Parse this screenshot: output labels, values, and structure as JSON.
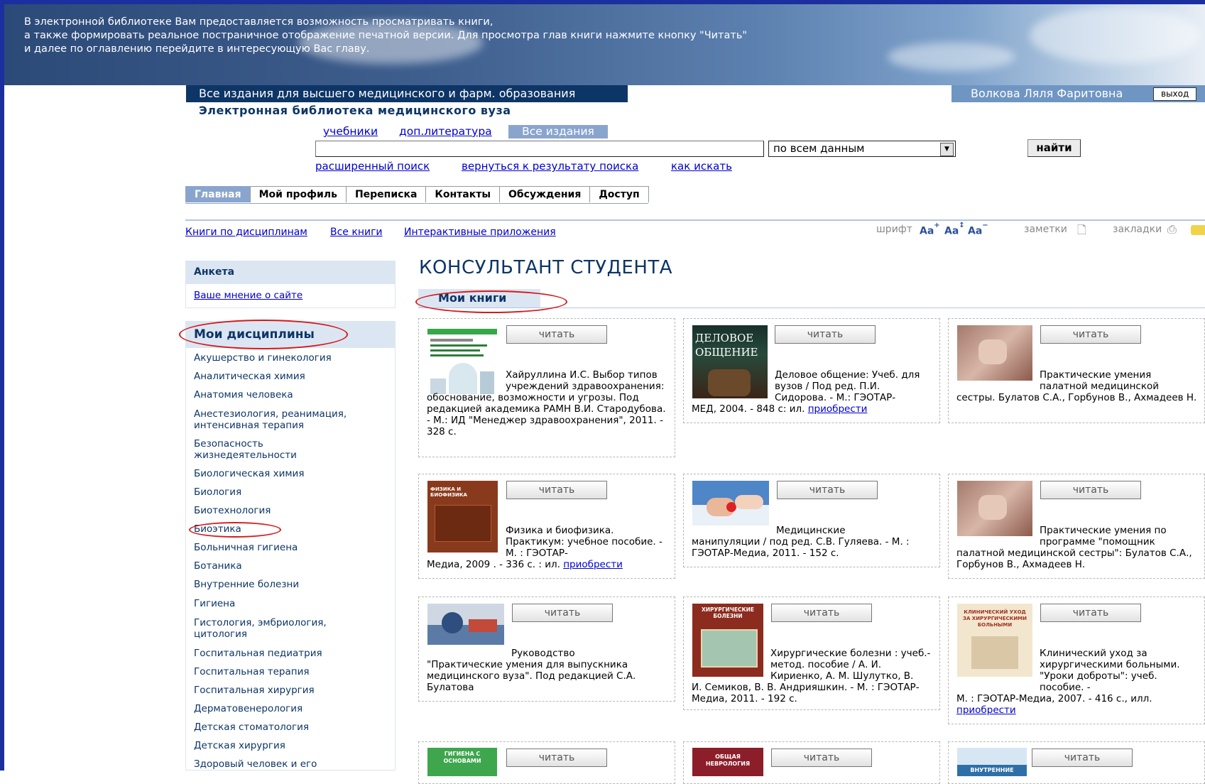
{
  "intro": [
    "В электронной библиотеке Вам предоставляется возможность просматривать книги,",
    "а также формировать реальное постраничное отображение печатной версии. Для просмотра глав книги нажмите кнопку \"Читать\"",
    "и далее по оглавлению перейдите в интересующую Вас главу."
  ],
  "header": {
    "scope": "Все издания для высшего медицинского и фарм. образования",
    "library_title": "Электронная библиотека медицинского вуза",
    "user_name": "Волкова Ляля Фаритовна",
    "logout": "выход"
  },
  "search": {
    "tabs": [
      "учебники",
      "доп.литература"
    ],
    "active_tab": "Все издания",
    "query": "",
    "scope_select": "по всем данным",
    "find_button": "найти",
    "links": [
      "расширенный поиск",
      "вернуться к результату поиска",
      "как искать"
    ]
  },
  "nav": {
    "tabs": [
      "Главная",
      "Мой профиль",
      "Переписка",
      "Контакты",
      "Обсуждения",
      "Доступ"
    ],
    "active": "Главная"
  },
  "sublinks": [
    "Книги по дисциплинам",
    "Все книги",
    "Интерактивные приложения"
  ],
  "tools": {
    "font_label": "шрифт",
    "notes_label": "заметки",
    "bookmarks_label": "закладки",
    "font_icon_glyph": "Aa"
  },
  "sidebar": {
    "survey_title": "Анкета",
    "survey_link": "Ваше мнение о сайте",
    "disciplines_title": "Мои дисциплины",
    "disciplines": [
      "Акушерство и гинекология",
      "Аналитическая химия",
      "Анатомия человека",
      "Анестезиология, реанимация, интенсивная терапия",
      "Безопасность жизнедеятельности",
      "Биологическая химия",
      "Биология",
      "Биотехнология",
      "Биоэтика",
      "Больничная гигиена",
      "Ботаника",
      "Внутренние болезни",
      "Гигиена",
      "Гистология, эмбриология, цитология",
      "Госпитальная педиатрия",
      "Госпитальная терапия",
      "Госпитальная хирургия",
      "Дерматовенерология",
      "Детская стоматология",
      "Детская хирургия",
      "Здоровый человек и его"
    ]
  },
  "main": {
    "title": "КОНСУЛЬТАНТ СТУДЕНТА",
    "tab": "Мои книги",
    "read_label": "читать",
    "buy_label": "приобрести",
    "books": [
      {
        "indent": "Хайруллина И.С. Выбор типов учреждений здравоохранения:",
        "text": "обоснование, возможности и угрозы. Под редакцией академика РАМН В.И. Стародубова. - М.: ИД \"Менеджер здравоохранения\", 2011. - 328 с.",
        "cover_text": ""
      },
      {
        "indent": "Деловое общение: Учеб. для вузов / Под ред. П.И. Сидорова. - М.: ГЭОТАР-",
        "text": "МЕД, 2004. - 848 с: ил.",
        "buy": true,
        "cover_text": "ДЕЛОВОЕ ОБЩЕНИЕ"
      },
      {
        "indent": "Практические умения палатной медицинской",
        "text": "сестры. Булатов С.А., Горбунов В., Ахмадеев Н.",
        "cover_text": ""
      },
      {
        "indent": "Физика и биофизика. Практикум: учебное пособие. - М. : ГЭОТАР-",
        "text": "Медиа, 2009 . - 336 с. : ил.",
        "buy": true,
        "cover_text": "ФИЗИКА И БИОФИЗИКА"
      },
      {
        "indent": "Медицинские",
        "text": "манипуляции / под ред. С.В. Гуляева. - М. : ГЭОТАР-Медиа, 2011. - 152 с.",
        "cover_text": ""
      },
      {
        "indent": "Практические умения по программе \"помощник",
        "text": "палатной медицинской сестры\": Булатов С.А., Горбунов В., Ахмадеев Н.",
        "cover_text": ""
      },
      {
        "indent": "Руководство",
        "text": "\"Практические умения для выпускника медицинского вуза\". Под редакцией С.А. Булатова",
        "cover_text": ""
      },
      {
        "indent": "Хирургические болезни : учеб.-метод. пособие / А. И. Кириенко, А. М. Шулутко, В.",
        "text": "И. Семиков, В. В. Андрияшкин. - М. : ГЭОТАР-Медиа, 2011. - 192 с.",
        "cover_text": "ХИРУРГИЧЕСКИЕ БОЛЕЗНИ"
      },
      {
        "indent": "Клинический уход за хирургическими больными. \"Уроки доброты\": учеб. пособие. -",
        "text": "М. : ГЭОТАР-Медиа, 2007. - 416 с., илл.",
        "buy": true,
        "cover_text": "КЛИНИЧЕСКИЙ УХОД ЗА ХИРУРГИЧЕСКИМИ БОЛЬНЫМИ"
      },
      {
        "indent": "",
        "text": "",
        "cover_text": "ГИГИЕНА С ОСНОВАМИ"
      },
      {
        "indent": "",
        "text": "",
        "cover_text": "ОБЩАЯ НЕВРОЛОГИЯ"
      },
      {
        "indent": "",
        "text": "",
        "cover_text": "ВНУТРЕННИЕ"
      }
    ]
  },
  "colors": {
    "brand_dark": "#0d3566",
    "accent": "#8aa5cd",
    "annotation_red": "#d41b1b"
  }
}
